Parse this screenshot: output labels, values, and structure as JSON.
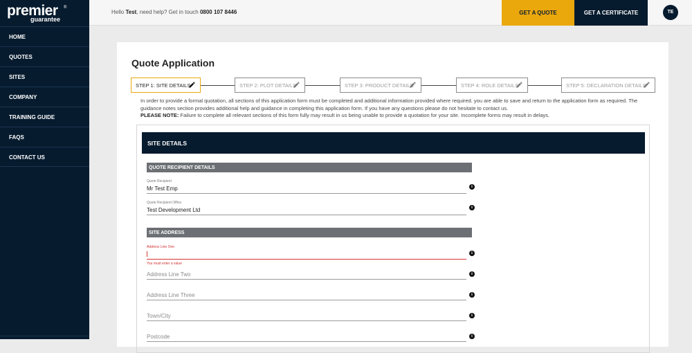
{
  "brand": {
    "name_main": "premier",
    "name_sub": "guarantee",
    "reg_mark": "®"
  },
  "sidebar": {
    "items": [
      {
        "label": "HOME"
      },
      {
        "label": "QUOTES"
      },
      {
        "label": "SITES"
      },
      {
        "label": "COMPANY"
      },
      {
        "label": "TRAINING GUIDE"
      },
      {
        "label": "FAQS"
      },
      {
        "label": "CONTACT US"
      }
    ]
  },
  "topbar": {
    "greeting_prefix": "Hello ",
    "user_name": "Test",
    "greeting_mid": ", need help? Get in touch ",
    "phone": "0800 107 8446",
    "get_quote_label": "GET A QUOTE",
    "get_certificate_label": "GET A CERTIFICATE",
    "avatar_initials": "TE"
  },
  "page": {
    "title": "Quote Application",
    "steps": [
      {
        "label": "STEP 1: SITE DETAILS"
      },
      {
        "label": "STEP 2: PLOT DETAILS"
      },
      {
        "label": "STEP 3: PRODUCT DETAILS"
      },
      {
        "label": "STEP 4: ROLE DETAILS"
      },
      {
        "label": "STEP 5: DECLARATION DETAILS"
      }
    ],
    "intro_text": "In order to provide a formal quotation, all sections of this application form must be completed and additional information provided where required. you are able to save and return to the application form as required. The guidance notes section provides additional help and guidance in completing this application form. If you have any questions please do not hesitate to contact us.",
    "note_label": "PLEASE NOTE:",
    "note_text": " Failure to complete all relevant sections of this form fully may result in us being unable to provide a quotation for your site. Incomplete forms may result in delays."
  },
  "form": {
    "section_title": "SITE DETAILS",
    "recipient_header": "QUOTE RECIPIENT DETAILS",
    "quote_recipient": {
      "label": "Quote Recipient",
      "value": "Mr Test Emp"
    },
    "quote_recipient_office": {
      "label": "Quote Recipient Office",
      "value": "Test Development Ltd"
    },
    "address_header": "SITE ADDRESS",
    "address_line_one": {
      "label": "Address Line One",
      "value": "",
      "error": "You must enter a value"
    },
    "address_line_two": {
      "placeholder": "Address Line Two"
    },
    "address_line_three": {
      "placeholder": "Address Line Three"
    },
    "town_city": {
      "placeholder": "Town/City"
    },
    "postcode": {
      "placeholder": "Postcode"
    },
    "info_glyph": "i"
  },
  "colors": {
    "navy": "#061b2e",
    "accent": "#eaa80c",
    "section_grey": "#6c6f73",
    "error": "#d23333"
  }
}
